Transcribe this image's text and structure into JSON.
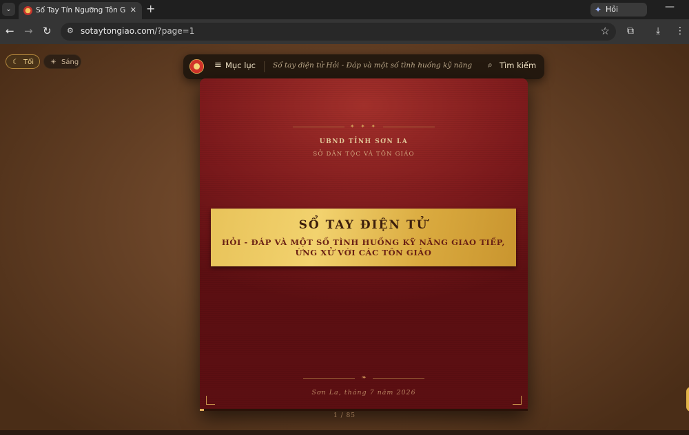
{
  "browser": {
    "tab_title": "Sổ Tay Tín Ngưỡng Tôn Giáo - Hỏi",
    "tab_close": "✕",
    "new_tab": "+",
    "gemini_label": "Hỏi Gemini",
    "url_host": "sotaytongiao.com",
    "url_path": "/?page=1",
    "icons": [
      "chevron-down-icon",
      "favicon",
      "close-icon",
      "plus-icon",
      "back-icon",
      "forward-icon",
      "reload-icon",
      "site-info-icon",
      "star-icon",
      "extensions-icon",
      "download-icon",
      "sparkle-icon",
      "minimize-icon"
    ]
  },
  "theme": {
    "dark_label": "Tối",
    "light_label": "Sáng"
  },
  "topnav": {
    "menu_label": "Mục lục",
    "doc_title": "Sổ tay điện tử Hỏi - Đáp và một số tình huống kỹ năng g...",
    "search_label": "Tìm kiếm"
  },
  "cover": {
    "issuer_line1": "UBND TỈNH SƠN LA",
    "issuer_line2": "SỞ DÂN TỘC VÀ TÔN GIÁO",
    "title": "SỔ TAY ĐIỆN TỬ",
    "subtitle": "HỎI - ĐÁP VÀ MỘT SỐ TÌNH HUỐNG KỸ NĂNG GIAO TIẾP, ỨNG XỬ VỚI CÁC TÔN GIÁO",
    "place_date": "Sơn La, tháng 7 năm 2026",
    "ornament_top": "✦ ✦ ✦",
    "ornament_bottom": "❧"
  },
  "pager": {
    "counter": "1 / 85",
    "progress_fraction": 0.0118
  },
  "colors": {
    "accent_gold": "#e0ad5b",
    "cover_red": "#7d1a1c",
    "background_brown": "#6a4428"
  }
}
